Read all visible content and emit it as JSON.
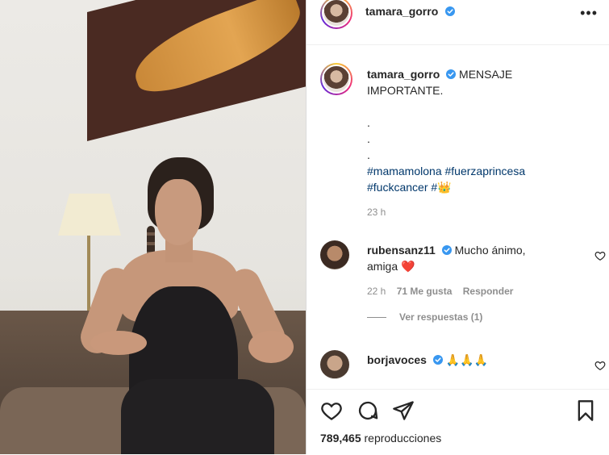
{
  "post": {
    "username": "tamara_gorro",
    "caption_lines": [
      "MENSAJE",
      "IMPORTANTE."
    ],
    "dots": [
      ".",
      ".",
      "."
    ],
    "hashtags_line1": [
      "#mamamolona",
      "#fuerzaprincesa"
    ],
    "hashtags_line2": [
      "#fuckcancer",
      "#"
    ],
    "caption_emoji": "👑",
    "caption_time": "23 h",
    "views_count": "789,465",
    "views_label": "reproducciones"
  },
  "comments": [
    {
      "username": "rubensanz11",
      "text_line1": "Mucho ánimo,",
      "text_line2": "amiga",
      "emoji": "❤️",
      "time": "22 h",
      "likes": "71 Me gusta",
      "reply": "Responder",
      "view_replies": "Ver respuestas (1)"
    },
    {
      "username": "borjavoces",
      "text": "🙏🙏🙏"
    }
  ],
  "icons": {
    "more": "more-options-icon",
    "verified": "verified-badge-icon",
    "like": "heart-icon",
    "comment": "comment-icon",
    "share": "paper-plane-icon",
    "save": "bookmark-icon"
  },
  "colors": {
    "verified": "#3897f0",
    "hashtag": "#00376b",
    "meta": "#8e8e8e",
    "heart_red": "#ed4956"
  }
}
